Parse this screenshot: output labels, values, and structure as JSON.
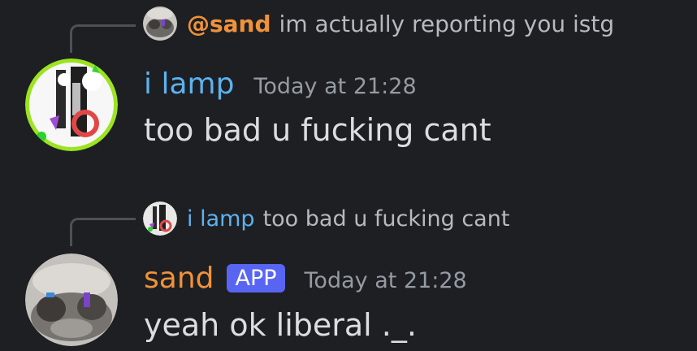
{
  "colors": {
    "background": "#1e1f22",
    "lamp_name": "#5db2f0",
    "sand_name": "#f0923a",
    "app_badge": "#5865f2",
    "timestamp": "#949ba4"
  },
  "messages": [
    {
      "reply": {
        "author": "@sand",
        "text": "im actually reporting you istg"
      },
      "author": "i lamp",
      "timestamp": "Today at 21:28",
      "content": "too bad u fucking cant"
    },
    {
      "reply": {
        "author": "i lamp",
        "text": "too bad u fucking cant"
      },
      "author": "sand",
      "badge": "APP",
      "timestamp": "Today at 21:28",
      "content": "yeah ok liberal ._."
    }
  ]
}
